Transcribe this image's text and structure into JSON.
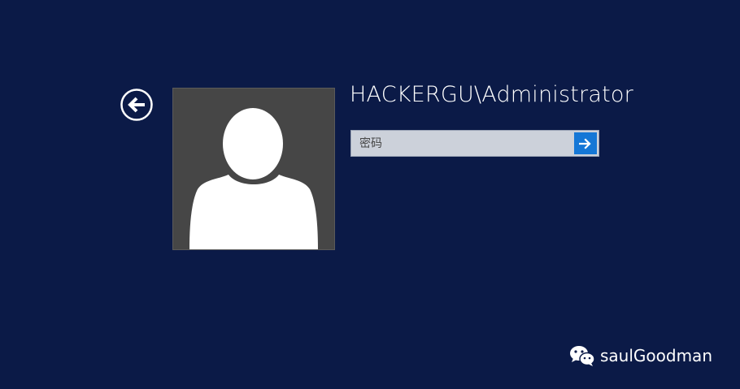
{
  "login": {
    "username": "HACKERGU\\Administrator",
    "password_placeholder": "密码",
    "password_value": ""
  },
  "icons": {
    "back": "back-arrow-icon",
    "submit": "arrow-right-icon",
    "avatar": "user-silhouette-icon",
    "watermark": "wechat-icon"
  },
  "watermark": {
    "text": "saulGoodman"
  },
  "colors": {
    "background": "#0b1a47",
    "avatar_bg": "#464646",
    "input_bg": "#ccd1da",
    "submit_bg": "#1577d6",
    "text": "#ffffff"
  }
}
